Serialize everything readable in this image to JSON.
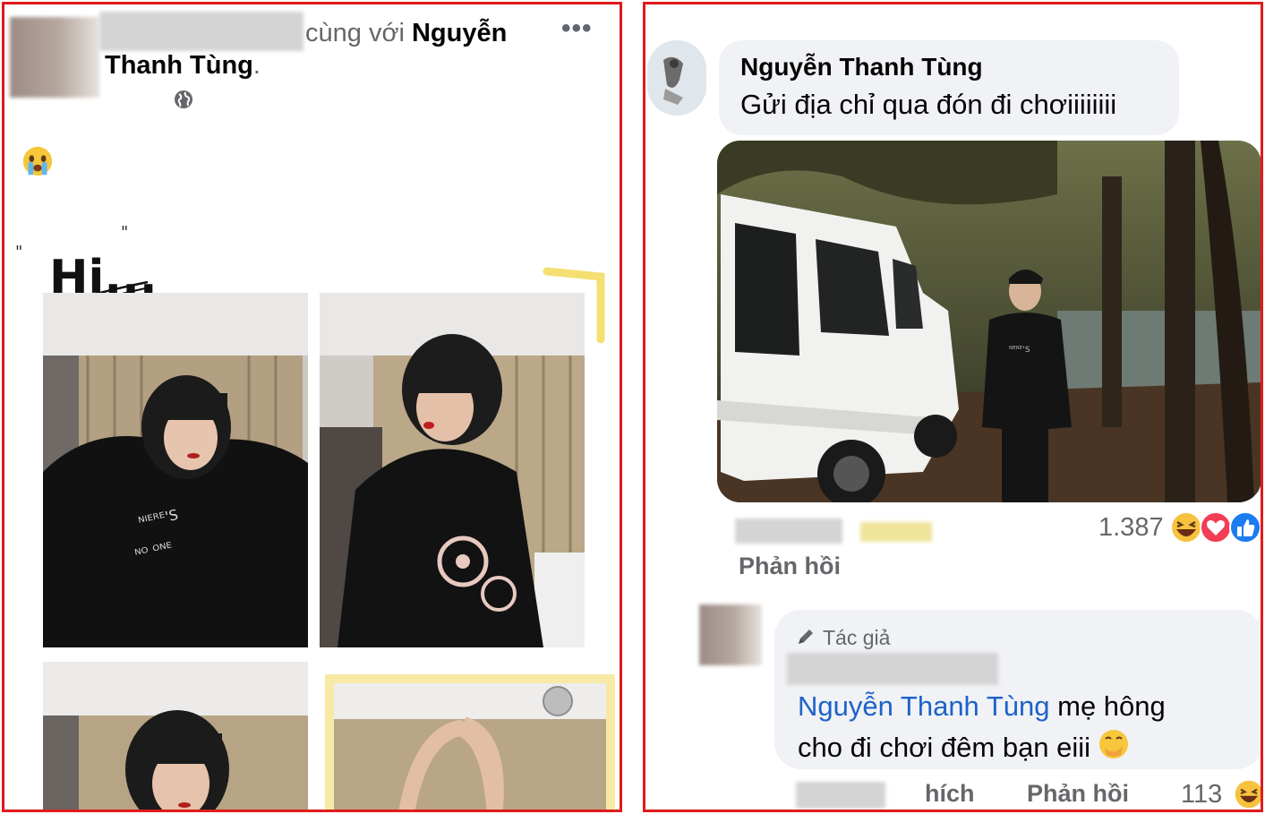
{
  "post": {
    "with_text": "cùng với",
    "tagged_name_line1": "Nguyễn",
    "tagged_name_line2": "Thanh Tùng",
    "tagged_suffix": ".",
    "more_icon": "more-dots-icon",
    "privacy_icon": "globe-icon",
    "emoji": "crying-face-emoji",
    "doodle_text": "Hi..."
  },
  "comment": {
    "author": "Nguyễn Thanh Tùng",
    "text": "Gửi địa chỉ qua đón đi chơiiiiiiii",
    "reply_label": "Phản hồi",
    "reaction_count": "1.387",
    "reactions": [
      "haha",
      "love",
      "like"
    ]
  },
  "reply": {
    "author_badge": "Tác giả",
    "mention": "Nguyễn Thanh Tùng",
    "text_after_mention": " mẹ hông",
    "text_line2": "cho đi chơi đêm bạn eiii",
    "like_label": "Thích",
    "like_label_visible": "hích",
    "reply_label": "Phản hồi",
    "reaction_count": "113",
    "reactions": [
      "haha"
    ]
  },
  "colors": {
    "frame_border": "#e01b1b",
    "mention_blue": "#1d62c9",
    "meta_grey": "#65676b",
    "bubble_bg": "#f0f2f5"
  }
}
